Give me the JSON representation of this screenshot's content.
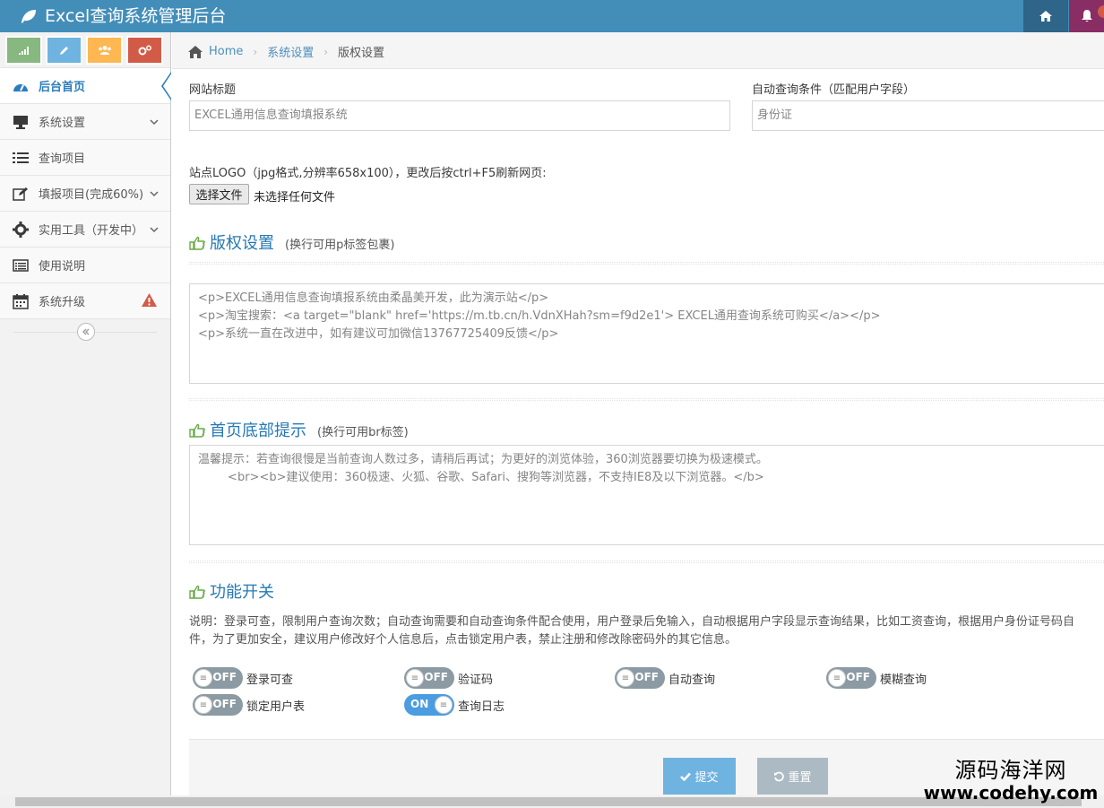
{
  "app": {
    "title": "Excel查询系统管理后台"
  },
  "colors": {
    "navbar": "#438eb9",
    "accent": "#2679b5",
    "submit": "#6fb3e0",
    "reset": "#abbac3"
  },
  "sidebar": {
    "shortcuts": [
      {
        "icon": "signal-icon",
        "color": "#87b87f"
      },
      {
        "icon": "pencil-icon",
        "color": "#6fb3e0"
      },
      {
        "icon": "users-icon",
        "color": "#ffb752"
      },
      {
        "icon": "cogs-icon",
        "color": "#d15b47"
      }
    ],
    "items": [
      {
        "label": "后台首页",
        "icon": "dashboard-icon",
        "active": true
      },
      {
        "label": "系统设置",
        "icon": "desktop-icon",
        "caret": true
      },
      {
        "label": "查询项目",
        "icon": "list-icon"
      },
      {
        "label": "填报项目(完成60%)",
        "icon": "edit-icon",
        "caret": true
      },
      {
        "label": "实用工具（开发中）",
        "icon": "gear-icon",
        "caret": true
      },
      {
        "label": "使用说明",
        "icon": "list-alt-icon"
      },
      {
        "label": "系统升级",
        "icon": "calendar-icon",
        "warning": true
      }
    ]
  },
  "breadcrumb": {
    "home": "Home",
    "level1": "系统设置",
    "current": "版权设置"
  },
  "form": {
    "site_title_label": "网站标题",
    "site_title_value": "EXCEL通用信息查询填报系统",
    "auto_query_label": "自动查询条件（匹配用户字段）",
    "auto_query_value": "身份证",
    "logo_label": "站点LOGO（jpg格式,分辨率658x100），更改后按ctrl+F5刷新网页:",
    "file_button": "选择文件",
    "file_status": "未选择任何文件"
  },
  "copyright": {
    "title": "版权设置",
    "hint": "(换行可用p标签包裹)",
    "content": "<p>EXCEL通用信息查询填报系统由柔晶美开发，此为演示站</p>\n<p>淘宝搜索：<a target=\"blank\" href='https://m.tb.cn/h.VdnXHah?sm=f9d2e1'> EXCEL通用查询系统可购买</a></p>\n<p>系统一直在改进中，如有建议可加微信13767725409反馈</p>"
  },
  "footer_tip": {
    "title": "首页底部提示",
    "hint": "(换行可用br标签)",
    "content": "温馨提示：若查询很慢是当前查询人数过多，请稍后再试；为更好的浏览体验，360浏览器要切换为极速模式。\n        <br><b>建议使用：360极速、火狐、谷歌、Safari、搜狗等浏览器，不支持IE8及以下浏览器。</b>"
  },
  "features": {
    "title": "功能开关",
    "description_line1": "说明：登录可查，限制用户查询次数；自动查询需要和自动查询条件配合使用，用户登录后免输入，自动根据用户字段显示查询结果，比如工资查询，根据用户身份证号码自",
    "description_line2": "件，为了更加安全，建议用户修改好个人信息后，点击锁定用户表，禁止注册和修改除密码外的其它信息。",
    "toggles": [
      {
        "label": "登录可查",
        "state": "OFF"
      },
      {
        "label": "验证码",
        "state": "OFF"
      },
      {
        "label": "自动查询",
        "state": "OFF"
      },
      {
        "label": "模糊查询",
        "state": "OFF"
      },
      {
        "label": "锁定用户表",
        "state": "OFF"
      },
      {
        "label": "查询日志",
        "state": "ON"
      }
    ]
  },
  "actions": {
    "submit": "提交",
    "reset": "重置"
  },
  "watermark": {
    "line1": "源码海洋网",
    "line2": "www.codehy.com"
  }
}
